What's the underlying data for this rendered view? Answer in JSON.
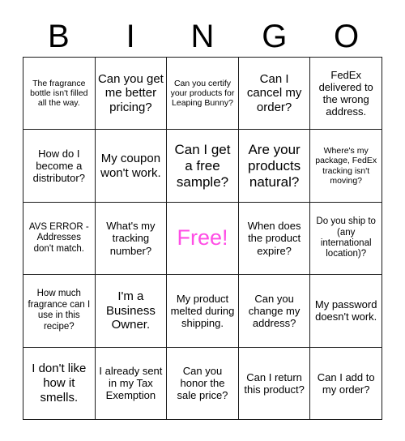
{
  "header": {
    "letters": [
      "B",
      "I",
      "N",
      "G",
      "O"
    ]
  },
  "colors": {
    "free_text": "#ff4de5",
    "grid_line": "#1a1a1a",
    "cell_background": "#ffffff",
    "text": "#000000"
  },
  "grid": {
    "columns": 5,
    "rows": 5,
    "cells": [
      {
        "text": "The fragrance bottle isn't filled all the way.",
        "size": "xs",
        "free": false
      },
      {
        "text": "Can you get me better pricing?",
        "size": "l",
        "free": false
      },
      {
        "text": "Can you certify your products for Leaping Bunny?",
        "size": "xs",
        "free": false
      },
      {
        "text": "Can I cancel my order?",
        "size": "l",
        "free": false
      },
      {
        "text": "FedEx delivered to the wrong address.",
        "size": "m",
        "free": false
      },
      {
        "text": "How do I become a distributor?",
        "size": "m",
        "free": false
      },
      {
        "text": "My coupon won't work.",
        "size": "l",
        "free": false
      },
      {
        "text": "Can I get a free sample?",
        "size": "xl",
        "free": false
      },
      {
        "text": "Are your products natural?",
        "size": "xl",
        "free": false
      },
      {
        "text": "Where's my package, FedEx tracking isn't moving?",
        "size": "xs",
        "free": false
      },
      {
        "text": "AVS ERROR - Addresses don't match.",
        "size": "s",
        "free": false
      },
      {
        "text": "What's my tracking number?",
        "size": "m",
        "free": false
      },
      {
        "text": "Free!",
        "size": "free",
        "free": true
      },
      {
        "text": "When does the product expire?",
        "size": "m",
        "free": false
      },
      {
        "text": "Do you ship to (any international location)?",
        "size": "s",
        "free": false
      },
      {
        "text": "How much fragrance can I use in this recipe?",
        "size": "s",
        "free": false
      },
      {
        "text": "I'm a Business Owner.",
        "size": "l",
        "free": false
      },
      {
        "text": "My product melted during shipping.",
        "size": "m",
        "free": false
      },
      {
        "text": "Can you change my address?",
        "size": "m",
        "free": false
      },
      {
        "text": "My password doesn't work.",
        "size": "m",
        "free": false
      },
      {
        "text": "I don't like how it smells.",
        "size": "l",
        "free": false
      },
      {
        "text": "I already sent in my Tax Exemption",
        "size": "m",
        "free": false
      },
      {
        "text": "Can you honor the sale price?",
        "size": "m",
        "free": false
      },
      {
        "text": "Can I return this product?",
        "size": "m",
        "free": false
      },
      {
        "text": "Can I add to my order?",
        "size": "m",
        "free": false
      }
    ]
  }
}
